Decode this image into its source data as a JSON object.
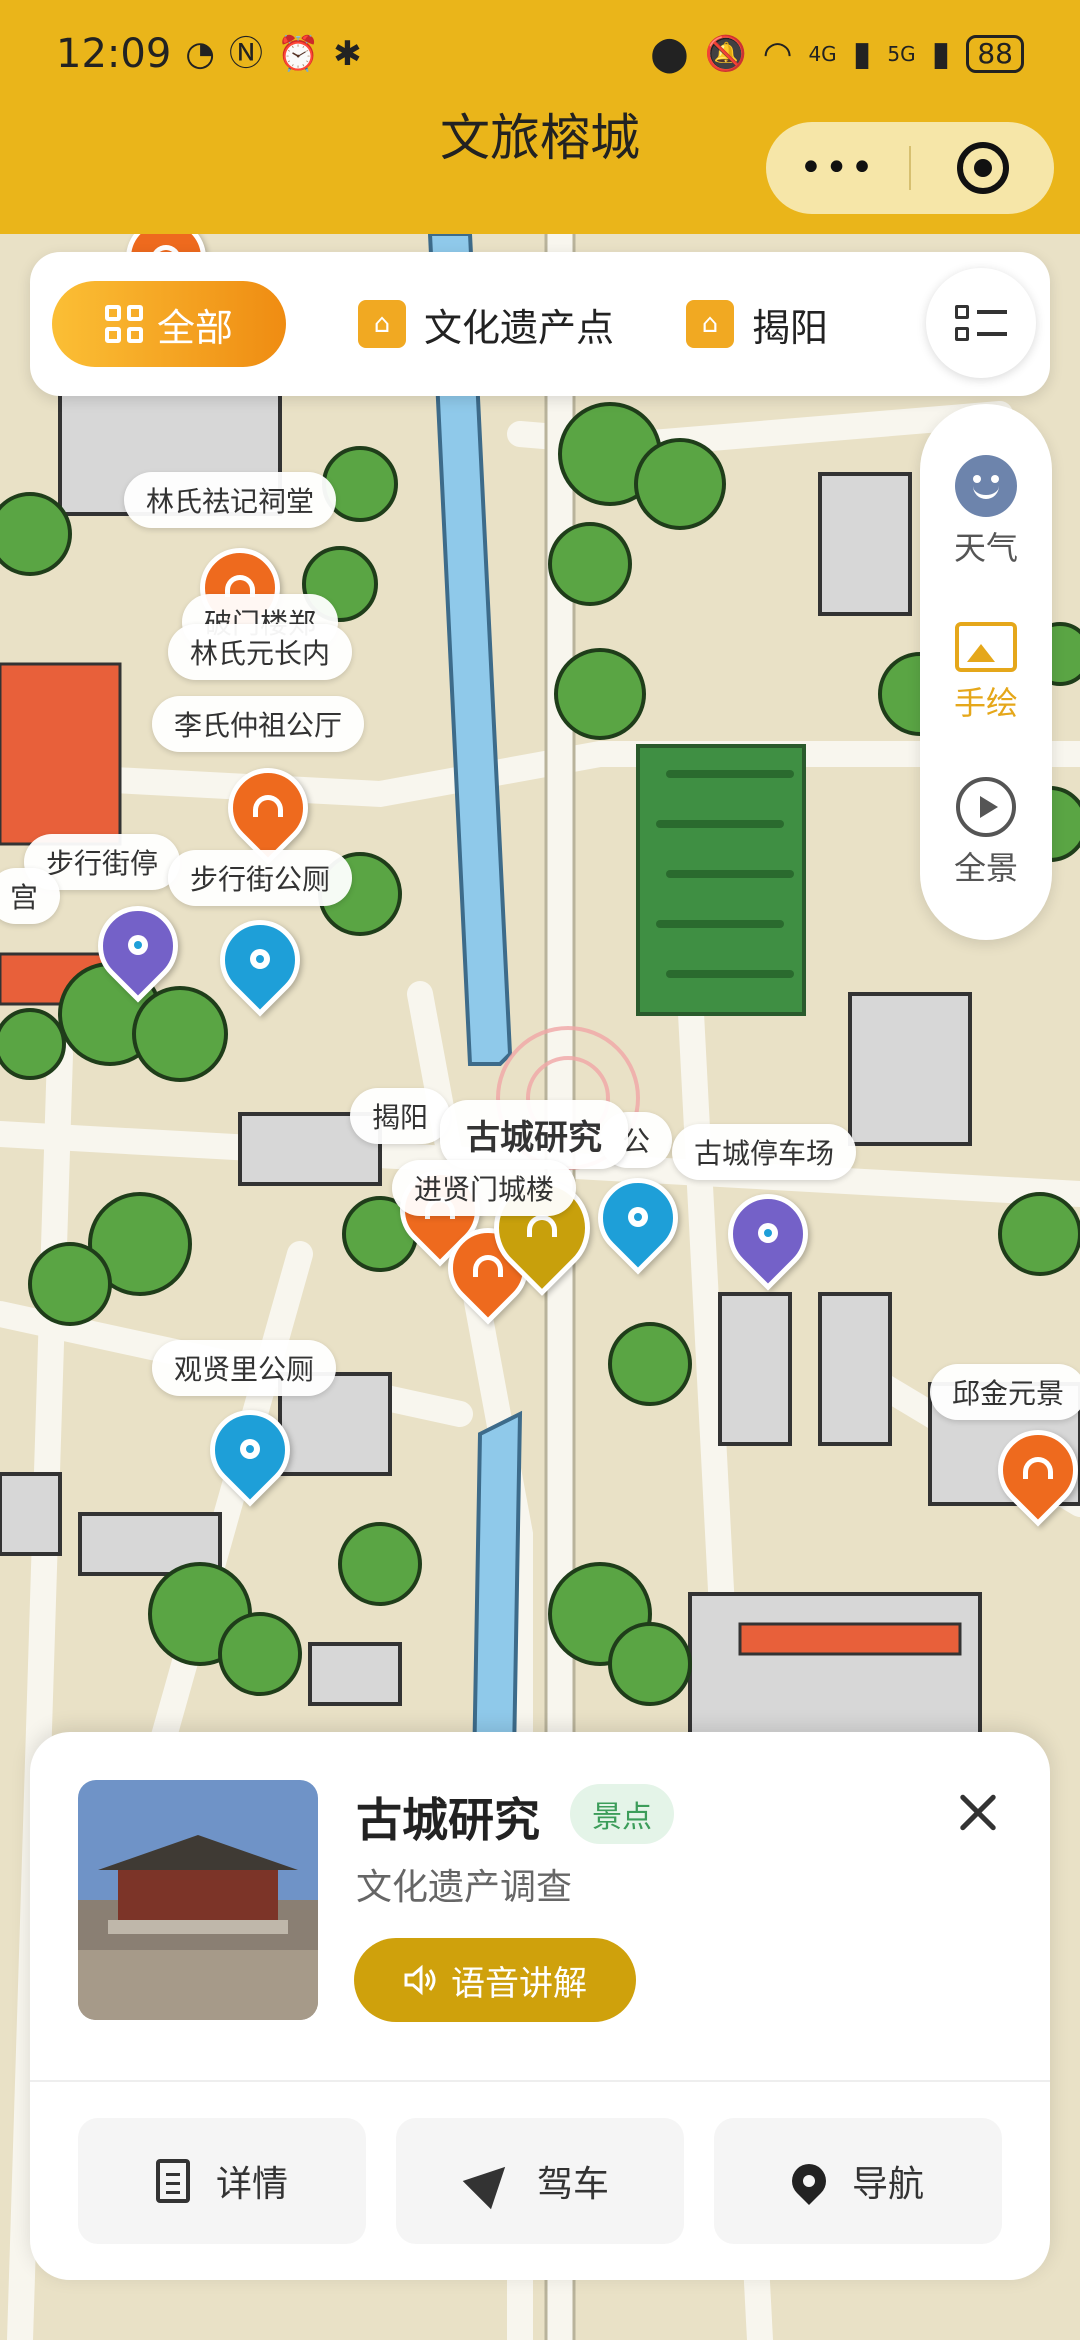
{
  "status_bar": {
    "time": "12:09",
    "battery": "88",
    "network_left": "4G",
    "network_right": "5G"
  },
  "header": {
    "title": "文旅榕城"
  },
  "categories": {
    "all": "全部",
    "items": [
      "文化遗产点",
      "揭阳"
    ]
  },
  "side_panel": {
    "weather": "天气",
    "hand_drawn": "手绘",
    "panorama": "全景"
  },
  "map_labels": {
    "lin_zuji": "林氏祛记祠堂",
    "pomen": "破门楼郑",
    "lin_yuanchang": "林氏元长内",
    "li_zhongzu": "李氏仲祖公厅",
    "buxingjie_ting": "步行街停",
    "buxingjie_gongce": "步行街公厕",
    "gong": "宫",
    "jieyang": "揭阳",
    "gucheng_yanjiu": "古城研究",
    "gong2": "公",
    "jinxian_men": "进贤门城楼",
    "gucheng_tingchechang": "古城停车场",
    "guanxianli": "观贤里公厕",
    "qiujinyuan": "邱金元景"
  },
  "card": {
    "title": "古城研究",
    "badge": "景点",
    "subtitle": "文化遗产调查",
    "audio_button": "语音讲解",
    "actions": {
      "details": "详情",
      "drive": "驾车",
      "navigate": "导航"
    }
  },
  "colors": {
    "brand": "#eab51a",
    "accent_orange": "#ef8c12",
    "audio_gold": "#cfa10c",
    "pin_orange": "#ee6a1e",
    "pin_blue": "#1e9fd8",
    "pin_purple": "#7461c8"
  }
}
